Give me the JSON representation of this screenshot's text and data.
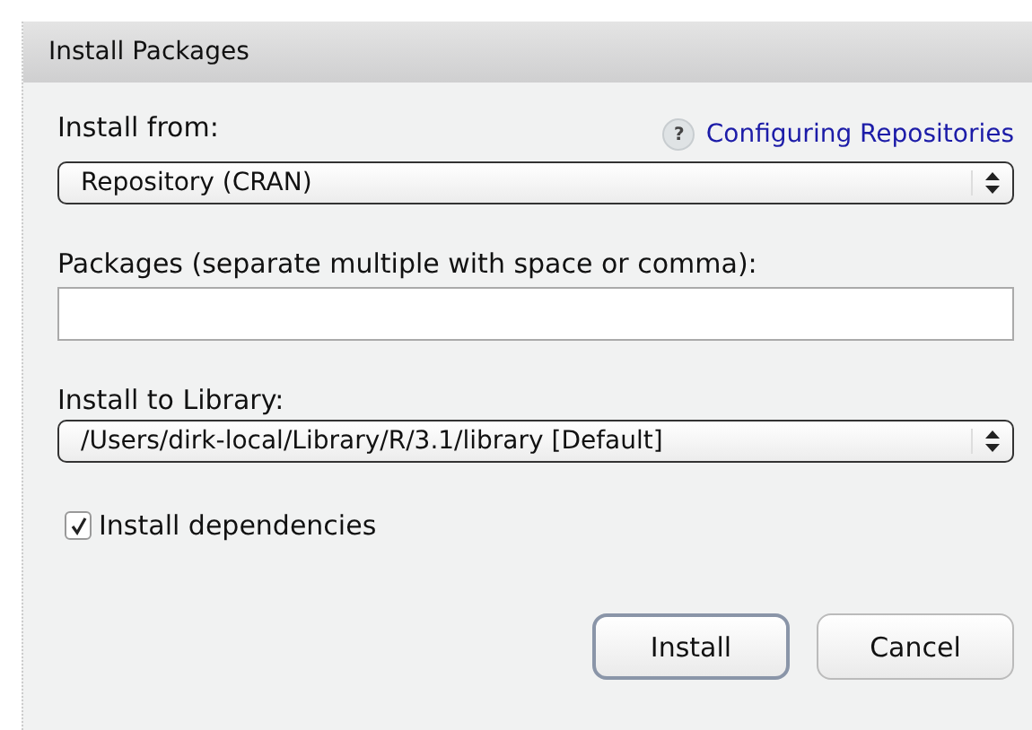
{
  "window": {
    "title": "Install Packages"
  },
  "install_from": {
    "label": "Install from:",
    "help_icon": "?",
    "help_link": "Configuring Repositories",
    "value": "Repository (CRAN)"
  },
  "packages": {
    "label": "Packages (separate multiple with space or comma):"
  },
  "library": {
    "label": "Install to Library:",
    "value": "/Users/dirk-local/Library/R/3.1/library [Default]"
  },
  "dependencies": {
    "label": "Install dependencies",
    "checked": true
  },
  "buttons": [
    {
      "label": "Install",
      "default": true
    },
    {
      "label": "Cancel",
      "default": false
    }
  ]
}
